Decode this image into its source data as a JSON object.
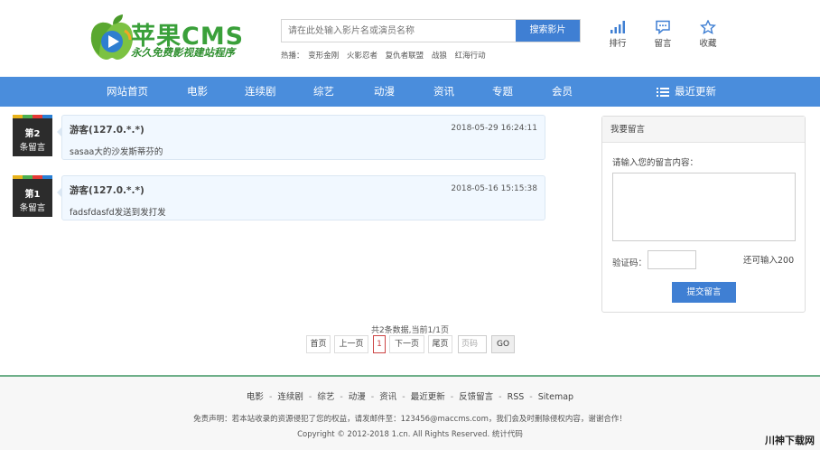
{
  "header": {
    "logo_text": "苹果CMS",
    "logo_sub": "永久免费影视建站程序",
    "search": {
      "placeholder": "请在此处输入影片名或演员名称",
      "button": "搜索影片"
    },
    "hot_label": "热播：",
    "hot_items": [
      "变形金刚",
      "火影忍者",
      "复仇者联盟",
      "战狼",
      "红海行动"
    ],
    "tools": [
      {
        "label": "排行",
        "icon": "bar-chart-icon"
      },
      {
        "label": "留言",
        "icon": "message-icon"
      },
      {
        "label": "收藏",
        "icon": "star-icon"
      }
    ]
  },
  "nav": {
    "items": [
      "网站首页",
      "电影",
      "连续剧",
      "综艺",
      "动漫",
      "资讯",
      "专题",
      "会员"
    ],
    "latest": "最近更新"
  },
  "messages": [
    {
      "num": "第2",
      "unit": "条留言",
      "user": "游客(127.0.*.*)",
      "time": "2018-05-29 16:24:11",
      "text": "sasaa大的沙发斯蒂芬的"
    },
    {
      "num": "第1",
      "unit": "条留言",
      "user": "游客(127.0.*.*)",
      "time": "2018-05-16 15:15:38",
      "text": "fadsfdasfd发送到发打发"
    }
  ],
  "form": {
    "title": "我要留言",
    "prompt": "请输入您的留言内容：",
    "captcha_label": "验证码：",
    "remain": "还可输入200",
    "submit": "提交留言"
  },
  "pagination": {
    "info": "共2条数据,当前1/1页",
    "first": "首页",
    "prev": "上一页",
    "current": "1",
    "next": "下一页",
    "last": "尾页",
    "input_placeholder": "页码",
    "go": "GO"
  },
  "footer": {
    "links": [
      "电影",
      "连续剧",
      "综艺",
      "动漫",
      "资讯",
      "最近更新",
      "反馈留言",
      "RSS",
      "Sitemap"
    ],
    "separator": "-",
    "disclaimer": "免责声明：若本站收录的资源侵犯了您的权益，请发邮件至：123456@maccms.com，我们会及时删除侵权内容，谢谢合作！",
    "copyright": "Copyright © 2012-2018 1.cn. All Rights Reserved. 统计代码"
  },
  "watermark": "川神下载网",
  "colors": {
    "nav_bg": "#4a8ddc",
    "button_bg": "#3f7fd3",
    "logo_green": "#3aa03a",
    "footer_border": "#6fb08a"
  }
}
